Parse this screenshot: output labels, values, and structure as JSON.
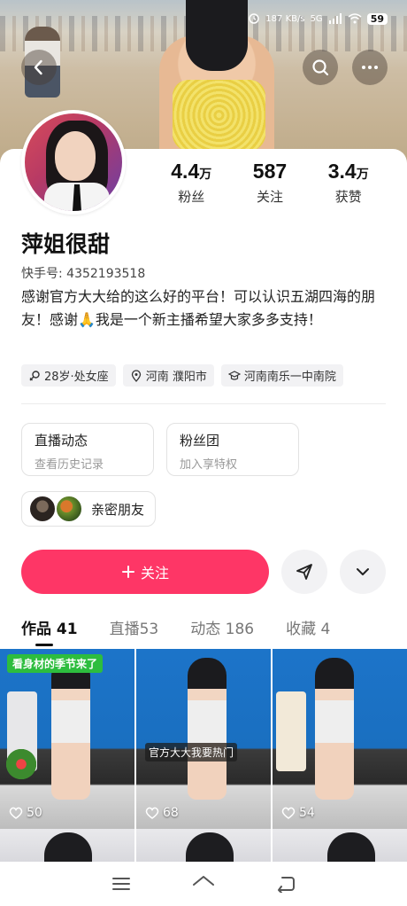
{
  "status_bar": {
    "speed": "187 KB/s",
    "network": "5G",
    "battery": "59"
  },
  "header": {
    "back_icon": "chevron-left-icon",
    "search_icon": "search-icon",
    "more_icon": "more-horizontal-icon"
  },
  "profile": {
    "username": "萍姐很甜",
    "kuaishou_id_label": "快手号: 4352193518",
    "bio": "感谢官方大大给的这么好的平台！可以认识五湖四海的朋友！感谢🙏我是一个新主播希望大家多多支持！",
    "stats": [
      {
        "value": "4.4",
        "unit": "万",
        "label": "粉丝"
      },
      {
        "value": "587",
        "unit": "",
        "label": "关注"
      },
      {
        "value": "3.4",
        "unit": "万",
        "label": "获赞"
      }
    ],
    "tags": [
      {
        "icon": "female-icon",
        "text": "28岁·处女座"
      },
      {
        "icon": "location-icon",
        "text": "河南 濮阳市"
      },
      {
        "icon": "school-icon",
        "text": "河南南乐一中南院"
      }
    ]
  },
  "feature_cards": [
    {
      "title": "直播动态",
      "subtitle": "查看历史记录"
    },
    {
      "title": "粉丝团",
      "subtitle": "加入享特权"
    }
  ],
  "friends": {
    "label": "亲密朋友"
  },
  "actions": {
    "follow_label": "关注",
    "share_icon": "send-icon",
    "expand_icon": "chevron-down-icon"
  },
  "tabs": [
    {
      "label": "作品",
      "count": "41",
      "active": true
    },
    {
      "label": "直播",
      "count": "53",
      "active": false
    },
    {
      "label": "动态",
      "count": "186",
      "active": false
    },
    {
      "label": "收藏",
      "count": "4",
      "active": false
    }
  ],
  "videos": [
    {
      "caption": "看身材的季节来了",
      "subtitle": "",
      "likes": "50"
    },
    {
      "caption": "",
      "subtitle": "官方大大我要热门",
      "likes": "68"
    },
    {
      "caption": "",
      "subtitle": "",
      "likes": "54"
    }
  ],
  "colors": {
    "accent": "#fe3666",
    "tag_bg": "#f2f2f4",
    "video_bg": "#1c74c9"
  },
  "nav": {
    "menu_icon": "menu-icon",
    "home_icon": "home-icon",
    "back_icon": "back-icon"
  }
}
